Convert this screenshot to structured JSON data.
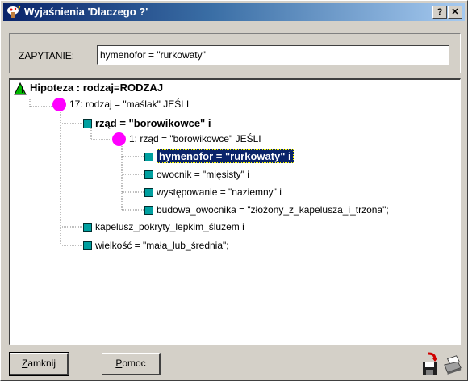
{
  "window": {
    "title": "Wyjaśnienia 'Dlaczego ?'"
  },
  "titlebar_buttons": {
    "help": "?",
    "close": "✕"
  },
  "query": {
    "label": "ZAPYTANIE:",
    "value": "hymenofor = \"rurkowaty\""
  },
  "tree": {
    "root": "Hipoteza : rodzaj=RODZAJ",
    "rule17": "17: rodzaj = \"maślak\" JEŚLI",
    "rzad": "rząd = \"borowikowce\" i",
    "rule1": "1: rząd = \"borowikowce\" JEŚLI",
    "hymenofor": "hymenofor = \"rurkowaty\" i",
    "owocnik": "owocnik = \"mięsisty\" i",
    "wystepowanie": "występowanie = \"naziemny\" i",
    "budowa": "budowa_owocnika = \"złożony_z_kapelusza_i_trzona\";",
    "kapelusz": "kapelusz_pokryty_lepkim_śluzem i",
    "wielkosc": "wielkość = \"mała_lub_średnia\";"
  },
  "buttons": {
    "close_first": "Z",
    "close_rest": "amknij",
    "help_first": "P",
    "help_rest": "omoc"
  },
  "icons": {
    "app": "mushroom-icon",
    "save": "save-disk-icon",
    "print": "printer-icon"
  },
  "colors": {
    "rule_node": "#ff00ff",
    "condition_node": "#00a0a0",
    "selection": "#0a246a",
    "titlebar": "#0a246a"
  }
}
